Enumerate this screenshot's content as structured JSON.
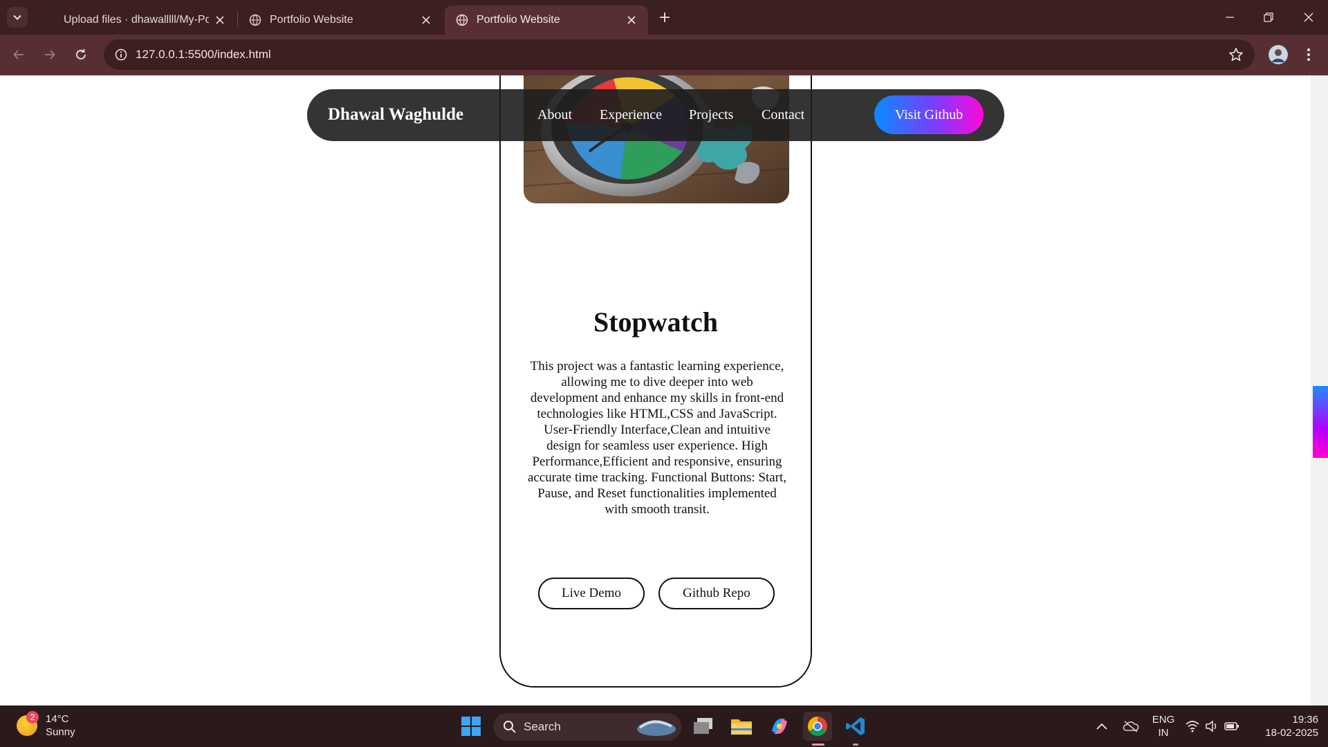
{
  "browser": {
    "tabs": [
      {
        "title": "Upload files · dhawalllll/My-Por",
        "active": false
      },
      {
        "title": "Portfolio Website",
        "active": false
      },
      {
        "title": "Portfolio Website",
        "active": true
      }
    ],
    "url": "127.0.0.1:5500/index.html"
  },
  "navbar": {
    "brand": "Dhawal Waghulde",
    "links": [
      "About",
      "Experience",
      "Projects",
      "Contact"
    ],
    "cta": "Visit Github"
  },
  "project": {
    "title": "Stopwatch",
    "description": "This project was a fantastic learning experience, allowing me to dive deeper into web development and enhance my skills in front-end technologies like HTML,CSS and JavaScript. User-Friendly Interface,Clean and intuitive design for seamless user experience. High Performance,Efficient and responsive, ensuring accurate time tracking. Functional Buttons: Start, Pause, and Reset functionalities implemented with smooth transit.",
    "buttons": [
      "Live Demo",
      "Github Repo"
    ]
  },
  "taskbar": {
    "weather": {
      "temp": "14°C",
      "condition": "Sunny",
      "badge": "2"
    },
    "search_label": "Search",
    "lang": {
      "line1": "ENG",
      "line2": "IN"
    },
    "time": "19:36",
    "date": "18-02-2025"
  },
  "colors": {
    "chrome_tabbar": "#3b1f21",
    "chrome_toolbar": "#572f33",
    "navbar_bg": "#1e1e1e",
    "cta_gradient_start": "#0a8bff",
    "cta_gradient_end": "#ff08d8"
  }
}
